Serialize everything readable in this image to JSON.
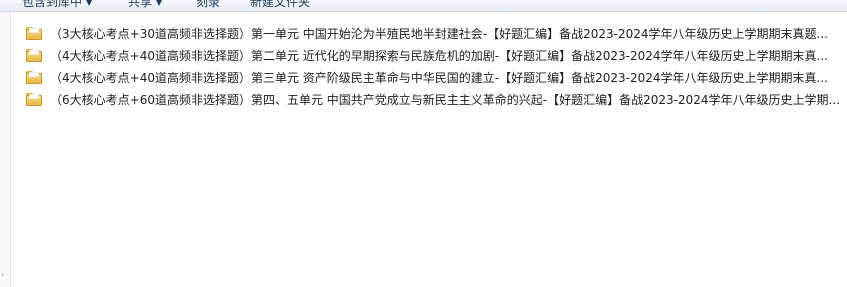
{
  "toolbar": {
    "items": [
      {
        "label": "包含到库中",
        "has_dropdown": true
      },
      {
        "label": "共享",
        "has_dropdown": true
      },
      {
        "label": "刻录",
        "has_dropdown": false
      },
      {
        "label": "新建文件夹",
        "has_dropdown": false
      }
    ]
  },
  "files": [
    {
      "icon": "folder-icon",
      "name": "（3大核心考点+30道高频非选择题）第一单元 中国开始沦为半殖民地半封建社会-【好题汇编】备战2023-2024学年八年级历史上学期期末真题..."
    },
    {
      "icon": "folder-icon",
      "name": "（4大核心考点+40道高频非选择题）第二单元 近代化的早期探索与民族危机的加剧-【好题汇编】备战2023-2024学年八年级历史上学期期末真..."
    },
    {
      "icon": "folder-icon",
      "name": "（4大核心考点+40道高频非选择题）第三单元 资产阶级民主革命与中华民国的建立-【好题汇编】备战2023-2024学年八年级历史上学期期末真..."
    },
    {
      "icon": "folder-icon",
      "name": "（6大核心考点+60道高频非选择题）第四、五单元 中国共产党成立与新民主主义革命的兴起-【好题汇编】备战2023-2024学年八年级历史上学期..."
    }
  ]
}
